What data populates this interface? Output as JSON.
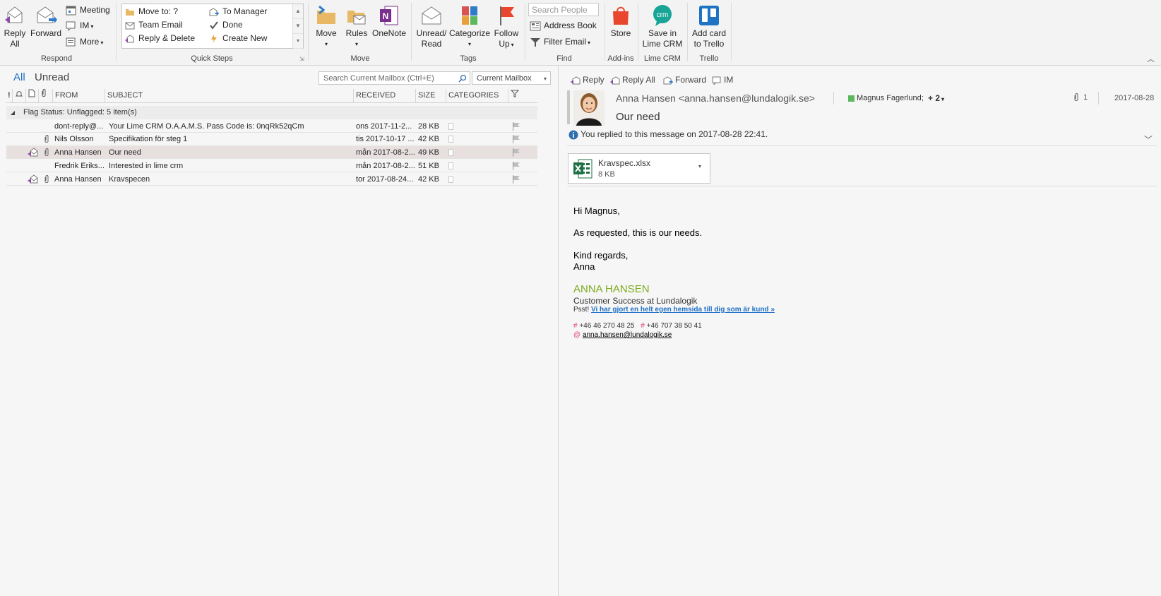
{
  "colors": {
    "accent": "#1f6fc5",
    "selected_row": "#e8dfdf",
    "signature_green": "#7cac1d",
    "lime_teal": "#16a596",
    "trello_blue": "#1e73c3",
    "store_red": "#e8462d",
    "onenote_purple": "#7a2e8e"
  },
  "ribbon": {
    "respond": {
      "label": "Respond",
      "reply_all_l1": "Reply",
      "reply_all_l2": "All",
      "forward": "Forward",
      "meeting": "Meeting",
      "im": "IM",
      "more": "More"
    },
    "quick_steps": {
      "label": "Quick Steps",
      "items": [
        "Move to: ?",
        "Team Email",
        "Reply & Delete",
        "To Manager",
        "Done",
        "Create New"
      ]
    },
    "move": {
      "label": "Move",
      "move": "Move",
      "rules": "Rules",
      "onenote": "OneNote"
    },
    "tags": {
      "label": "Tags",
      "unread_l1": "Unread/",
      "unread_l2": "Read",
      "categorize": "Categorize",
      "follow_l1": "Follow",
      "follow_l2": "Up"
    },
    "find": {
      "label": "Find",
      "search_people_placeholder": "Search People",
      "address_book": "Address Book",
      "filter_email": "Filter Email"
    },
    "addins": {
      "label": "Add-ins",
      "store": "Store"
    },
    "limecrm": {
      "label": "Lime CRM",
      "save_l1": "Save in",
      "save_l2": "Lime CRM",
      "icon_text": "crm"
    },
    "trello": {
      "label": "Trello",
      "add_l1": "Add card",
      "add_l2": "to Trello"
    }
  },
  "list": {
    "tab_all": "All",
    "tab_unread": "Unread",
    "search_placeholder": "Search Current Mailbox (Ctrl+E)",
    "scope": "Current Mailbox",
    "headers": {
      "importance": "!",
      "from": "FROM",
      "subject": "SUBJECT",
      "received": "RECEIVED",
      "size": "SIZE",
      "categories": "CATEGORIES"
    },
    "group_header": "Flag Status: Unflagged: 5 item(s)",
    "rows": [
      {
        "from": "dont-reply@...",
        "subject": "Your Lime CRM O.A.A.M.S. Pass Code is: 0nqRk52qCm",
        "received": "ons 2017-11-2...",
        "size": "28 KB",
        "attachment": false,
        "replied": false,
        "selected": false
      },
      {
        "from": "Nils Olsson",
        "subject": "Specifikation för steg 1",
        "received": "tis 2017-10-17 ...",
        "size": "42 KB",
        "attachment": true,
        "replied": false,
        "selected": false
      },
      {
        "from": "Anna Hansen",
        "subject": "Our need",
        "received": "mån 2017-08-2...",
        "size": "49 KB",
        "attachment": true,
        "replied": true,
        "selected": true
      },
      {
        "from": "Fredrik Eriks...",
        "subject": "Interested in lime crm",
        "received": "mån 2017-08-2...",
        "size": "51 KB",
        "attachment": false,
        "replied": false,
        "selected": false
      },
      {
        "from": "Anna Hansen",
        "subject": "Kravspecen",
        "received": "tor 2017-08-24...",
        "size": "42 KB",
        "attachment": true,
        "replied": true,
        "selected": false
      }
    ]
  },
  "reading": {
    "actions": {
      "reply": "Reply",
      "reply_all": "Reply All",
      "forward": "Forward",
      "im": "IM"
    },
    "sender": "Anna Hansen <anna.hansen@lundalogik.se>",
    "recipient": "Magnus Fagerlund;",
    "more_recipients": "+ 2",
    "attachment_count": "1",
    "date": "2017-08-28",
    "subject": "Our need",
    "info": "You replied to this message on 2017-08-28 22:41.",
    "attachment": {
      "name": "Kravspec.xlsx",
      "size": "8 KB"
    },
    "body": {
      "greeting": "Hi Magnus,",
      "line1": "As requested, this is our needs.",
      "closing": "Kind regards,",
      "name": "Anna"
    },
    "signature": {
      "name": "ANNA HANSEN",
      "title": "Customer Success at Lundalogik",
      "psst": "Psst!",
      "link": "Vi har gjort en helt egen hemsida till dig som är kund »",
      "phone1": "+46 46 270 48 25",
      "phone2": "+46 707 38 50 41",
      "email": "anna.hansen@lundalogik.se"
    }
  }
}
